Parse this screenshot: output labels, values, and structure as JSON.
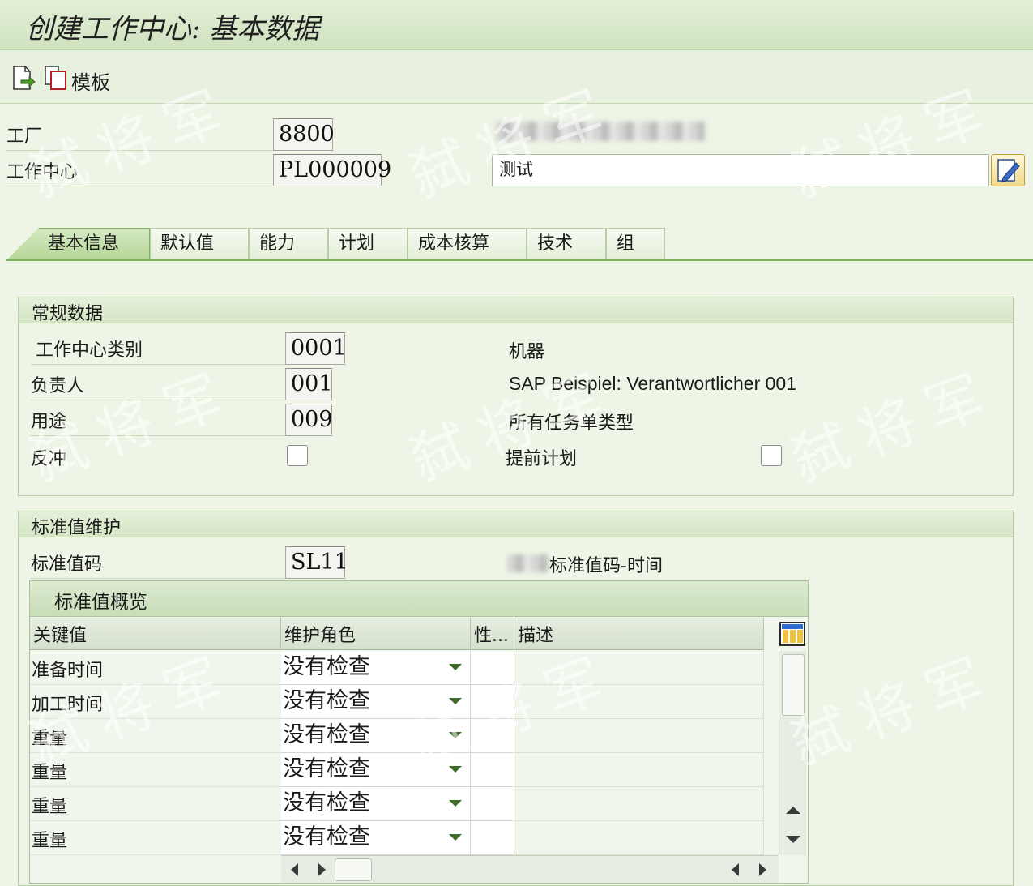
{
  "window": {
    "title": "创建工作中心: 基本数据"
  },
  "toolbar": {
    "template_label": "模板"
  },
  "header": {
    "plant_label": "工厂",
    "plant_value": "8800",
    "workcenter_label": "工作中心",
    "workcenter_value": "PL000009",
    "description_value": "测试"
  },
  "tabs": [
    {
      "label": "基本信息",
      "active": true
    },
    {
      "label": "默认值"
    },
    {
      "label": "能力"
    },
    {
      "label": "计划"
    },
    {
      "label": "成本核算"
    },
    {
      "label": "技术"
    },
    {
      "label": "组"
    }
  ],
  "general": {
    "title": "常规数据",
    "category_label": "工作中心类别",
    "category_value": "0001",
    "category_text": "机器",
    "responsible_label": "负责人",
    "responsible_value": "001",
    "responsible_text": "SAP Beispiel: Verantwortlicher 001",
    "usage_label": "用途",
    "usage_value": "009",
    "usage_text": "所有任务单类型",
    "backflush_label": "反冲",
    "advanced_plan_label": "提前计划"
  },
  "standard": {
    "title": "标准值维护",
    "key_label": "标准值码",
    "key_value": "SL11",
    "key_text": "标准值码-时间",
    "overview_title": "标准值概览",
    "columns": [
      "关键值",
      "维护角色",
      "性...",
      "描述"
    ],
    "rows": [
      {
        "key": "准备时间",
        "role": "没有检查"
      },
      {
        "key": "加工时间",
        "role": "没有检查"
      },
      {
        "key": "重量",
        "role": "没有检查"
      },
      {
        "key": "重量",
        "role": "没有检查"
      },
      {
        "key": "重量",
        "role": "没有检查"
      },
      {
        "key": "重量",
        "role": "没有检查"
      }
    ]
  },
  "watermark": {
    "text": "弑将军"
  },
  "colors": {
    "accent": "#86b362",
    "background": "#eef5e6"
  }
}
